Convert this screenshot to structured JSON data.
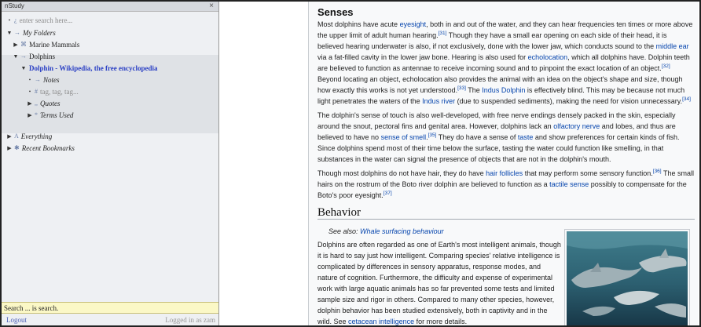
{
  "sidebar": {
    "title": "nStudy",
    "close": "×",
    "search_placeholder": "enter search here...",
    "tree": {
      "my_folders": "My Folders",
      "marine_mammals": "Marine Mammals",
      "dolphins": "Dolphins",
      "page": "Dolphin - Wikipedia, the free encyclopedia",
      "notes": "Notes",
      "tags": "tag, tag, tag...",
      "quotes": "Quotes",
      "terms_used": "Terms Used",
      "everything": "Everything",
      "recent_bookmarks": "Recent Bookmarks"
    },
    "search_status": "Search ... is search.",
    "logout": "Logout",
    "logged_in_as": "Logged in as zam"
  },
  "article": {
    "senses_heading": "Senses",
    "behavior_heading": "Behavior",
    "see_also_label": "See also: ",
    "see_also_link": "Whale surfacing behaviour",
    "p1": {
      "a": "Most dolphins have acute ",
      "l1": "eyesight",
      "b": ", both in and out of the water, and they can hear frequencies ten times or more above the upper limit of adult human hearing.",
      "r1": "[31]",
      "c": " Though they have a small ear opening on each side of their head, it is believed hearing underwater is also, if not exclusively, done with the lower jaw, which conducts sound to the ",
      "l2": "middle ear",
      "d": " via a fat-filled cavity in the lower jaw bone. Hearing is also used for ",
      "l3": "echolocation",
      "e": ", which all dolphins have. Dolphin teeth are believed to function as antennae to receive incoming sound and to pinpoint the exact location of an object.",
      "r2": "[32]",
      "f": " Beyond locating an object, echolocation also provides the animal with an idea on the object's shape and size, though how exactly this works is not yet understood.",
      "r3": "[33]",
      "g": " The ",
      "l4": "Indus Dolphin",
      "h": " is effectively blind. This may be because not much light penetrates the waters of the ",
      "l5": "Indus river",
      "i": " (due to suspended sediments), making the need for vision unnecessary.",
      "r4": "[34]"
    },
    "p2": {
      "a": "The dolphin's sense of touch is also well-developed, with free nerve endings densely packed in the skin, especially around the snout, pectoral fins and genital area. However, dolphins lack an ",
      "l1": "olfactory nerve",
      "b": " and lobes, and thus are believed to have no ",
      "l2": "sense of smell",
      "r1": "[35]",
      "c": " They do have a sense of ",
      "l3": "taste",
      "d": " and show preferences for certain kinds of fish. Since dolphins spend most of their time below the surface, tasting the water could function like smelling, in that substances in the water can signal the presence of objects that are not in the dolphin's mouth."
    },
    "p3": {
      "a": "Though most dolphins do not have hair, they do have ",
      "l1": "hair follicles",
      "b": " that may perform some sensory function.",
      "r1": "[36]",
      "c": " The small hairs on the rostrum of the Boto river dolphin are believed to function as a ",
      "l2": "tactile sense",
      "d": " possibly to compensate for the Boto's poor eyesight.",
      "r2": "[37]"
    },
    "p4": {
      "a": "Dolphins are often regarded as one of Earth's most intelligent animals, though it is hard to say just how intelligent. Comparing species' relative intelligence is complicated by differences in sensory apparatus, response modes, and nature of cognition. Furthermore, the difficulty and expense of experimental work with large aquatic animals has so far prevented some tests and limited sample size and rigor in others. Compared to many other species, however, dolphin behavior has been studied extensively, both in captivity and in the wild. See ",
      "l1": "cetacean intelligence",
      "b": " for more details."
    }
  }
}
